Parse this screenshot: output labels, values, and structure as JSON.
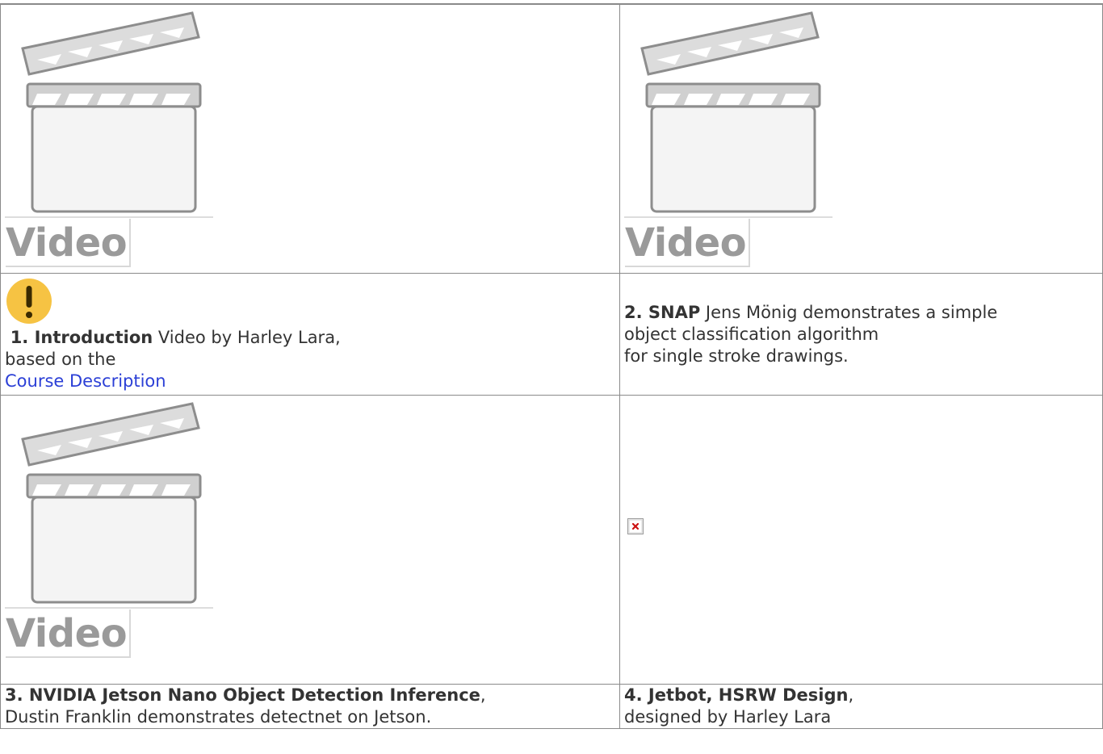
{
  "videos": {
    "label": "Video"
  },
  "rows": {
    "caption1": {
      "num": "1. Introduction",
      "line1_rest": " Video by Harley Lara,",
      "line2": "based on the",
      "link": "Course Description"
    },
    "caption2": {
      "num": "2. SNAP",
      "line1_rest": " Jens Mönig demonstrates a simple",
      "line2": "object classification algorithm",
      "line3": "for single stroke drawings."
    },
    "caption3": {
      "num": "3. NVIDIA Jetson Nano Object Detection Inference",
      "punct": ",",
      "line2": "Dustin Franklin demonstrates detectnet on Jetson."
    },
    "caption4": {
      "num": "4. Jetbot, HSRW Design",
      "punct": ",",
      "line2": "designed by Harley Lara"
    }
  },
  "colors": {
    "warning": "#f6c343",
    "link": "#2b3fd6",
    "border": "#8a8a8a"
  },
  "icons": {
    "warning": "exclamation-circle-icon",
    "video": "clapperboard-icon",
    "broken_image": "broken-image-icon"
  }
}
